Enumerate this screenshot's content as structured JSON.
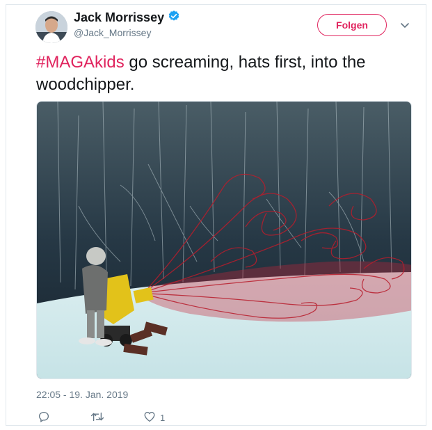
{
  "author": {
    "name": "Jack Morrissey",
    "handle": "@Jack_Morrissey",
    "verified": true
  },
  "follow_button": {
    "label": "Folgen"
  },
  "tweet": {
    "hashtag": "#MAGAkids",
    "text": " go screaming, hats first, into the woodchipper."
  },
  "timestamp": "22:05 - 19. Jan. 2019",
  "actions": {
    "like_count": "1"
  },
  "colors": {
    "accent": "#e0245e",
    "verified": "#1da1f2",
    "muted": "#657786"
  },
  "icons": [
    "verified-badge-icon",
    "chevron-down-icon",
    "reply-icon",
    "retweet-icon",
    "like-icon"
  ]
}
